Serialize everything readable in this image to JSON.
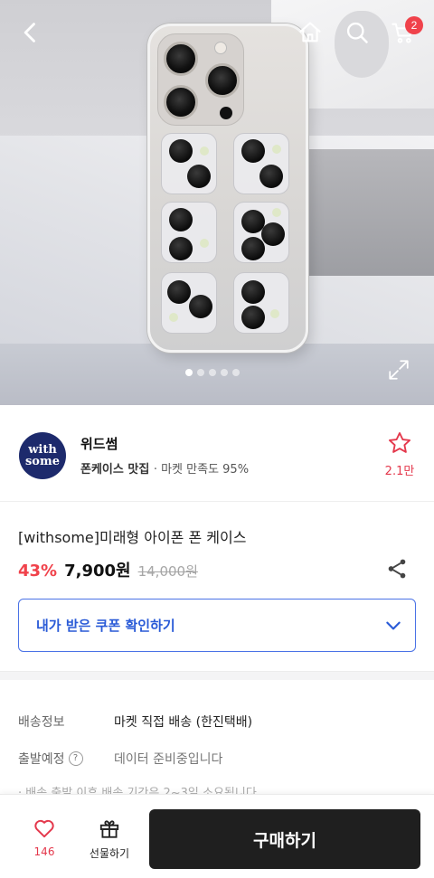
{
  "header": {
    "back_icon": "chevron-left-icon",
    "home_icon": "home-icon",
    "search_icon": "search-icon",
    "cart_icon": "cart-icon",
    "cart_count": "2"
  },
  "gallery": {
    "image_count": 5,
    "active_index": 0
  },
  "seller": {
    "logo_line1": "with",
    "logo_line2": "some",
    "name": "위드썸",
    "tag": "폰케이스 맛집",
    "satisfaction": "· 마켓 만족도 95%",
    "favorite_count": "2.1만"
  },
  "product": {
    "title": "[withsome]미래형 아이폰 폰 케이스",
    "discount": "43%",
    "price": "7,900원",
    "original_price": "14,000원"
  },
  "coupon": {
    "label": "내가 받은 쿠폰 확인하기"
  },
  "shipping": {
    "rows": [
      {
        "key": "배송정보",
        "value": "마켓 직접 배송 (한진택배)"
      },
      {
        "key": "출발예정",
        "value": "데이터 준비중입니다"
      }
    ],
    "note": "· 배송 출발 이후 배송 기간은 2~3일 소요됩니다"
  },
  "bottom_bar": {
    "like_count": "146",
    "gift_label": "선물하기",
    "buy_label": "구매하기"
  },
  "colors": {
    "accent_red": "#f0424b",
    "accent_blue": "#2a5bd7",
    "buy_button": "#1f1f1f",
    "seller_logo_bg": "#1d2a6c"
  }
}
